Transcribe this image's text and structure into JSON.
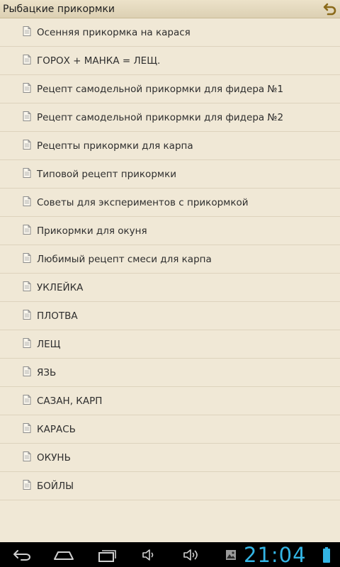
{
  "app": {
    "title": "Рыбацкие прикормки"
  },
  "list": {
    "items": [
      {
        "label": "Осенняя прикормка на карася"
      },
      {
        "label": "ГОРОХ + МАНКА = ЛЕЩ."
      },
      {
        "label": "Рецепт самодельной прикормки для фидера №1"
      },
      {
        "label": "Рецепт самодельной прикормки для фидера №2"
      },
      {
        "label": "Рецепты прикормки для карпа"
      },
      {
        "label": "Типовой рецепт прикормки"
      },
      {
        "label": "Советы для экспериментов с прикормкой"
      },
      {
        "label": "Прикормки для окуня"
      },
      {
        "label": "Любимый рецепт смеси для карпа"
      },
      {
        "label": "УКЛЕЙКА"
      },
      {
        "label": "ПЛОТВА"
      },
      {
        "label": "ЛЕЩ"
      },
      {
        "label": "ЯЗЬ"
      },
      {
        "label": "САЗАН, КАРП"
      },
      {
        "label": "КАРАСЬ"
      },
      {
        "label": "ОКУНЬ"
      },
      {
        "label": "БОЙЛЫ"
      }
    ]
  },
  "status": {
    "time": "21:04"
  },
  "icons": {
    "back": "back-arrow-icon",
    "item": "document-icon",
    "nav_back": "nav-back-icon",
    "nav_home": "nav-home-icon",
    "nav_recent": "nav-recent-apps-icon",
    "vol_down": "volume-down-icon",
    "vol_up": "volume-up-icon",
    "gallery": "gallery-notification-icon",
    "battery": "battery-icon"
  },
  "colors": {
    "background": "#f0e8d6",
    "clock": "#33b5e5",
    "back_arrow": "#b8860b",
    "navbar": "#000000"
  }
}
